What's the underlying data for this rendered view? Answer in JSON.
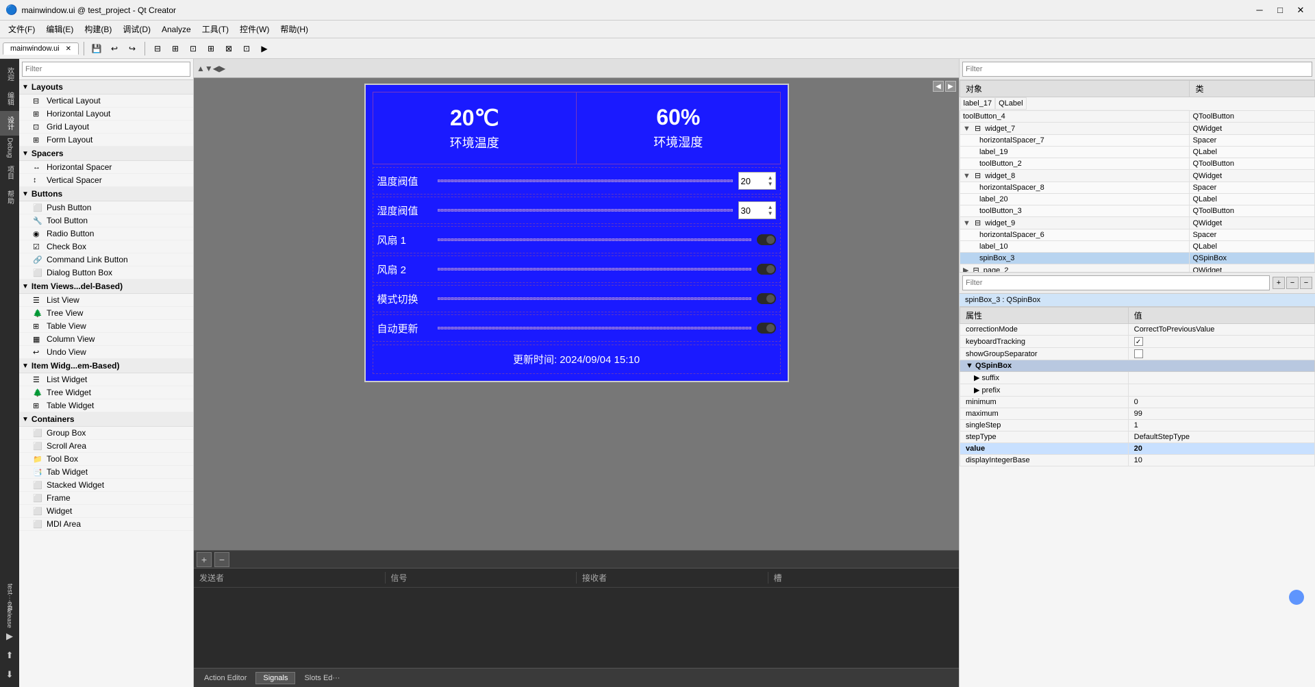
{
  "window": {
    "title": "mainwindow.ui @ test_project - Qt Creator",
    "minimize": "─",
    "maximize": "□",
    "close": "✕"
  },
  "menubar": {
    "items": [
      "文件(F)",
      "编辑(E)",
      "构建(B)",
      "调试(D)",
      "Analyze",
      "工具(T)",
      "控件(W)",
      "帮助(H)"
    ]
  },
  "toolbar": {
    "tab": "mainwindow.ui",
    "close_tab": "✕"
  },
  "left_nav": {
    "buttons": [
      "欢迎",
      "编辑",
      "设计",
      "Debug",
      "项目",
      "帮助"
    ]
  },
  "widget_panel": {
    "filter_placeholder": "Filter",
    "sections": {
      "layouts": {
        "label": "Layouts",
        "items": [
          {
            "icon": "▦",
            "label": "Vertical Layout"
          },
          {
            "icon": "▤",
            "label": "Horizontal Layout"
          },
          {
            "icon": "▣",
            "label": "Grid Layout"
          },
          {
            "icon": "▥",
            "label": "Form Layout"
          }
        ]
      },
      "spacers": {
        "label": "Spacers",
        "items": [
          {
            "icon": "↔",
            "label": "Horizontal Spacer"
          },
          {
            "icon": "↕",
            "label": "Vertical Spacer"
          }
        ]
      },
      "buttons": {
        "label": "Buttons",
        "items": [
          {
            "icon": "⬜",
            "label": "Push Button"
          },
          {
            "icon": "🔧",
            "label": "Tool Button"
          },
          {
            "icon": "◉",
            "label": "Radio Button"
          },
          {
            "icon": "☑",
            "label": "Check Box"
          },
          {
            "icon": "🔗",
            "label": "Command Link Button"
          },
          {
            "icon": "⬜",
            "label": "Dialog Button Box"
          }
        ]
      },
      "itemviews": {
        "label": "Item Views...del-Based)",
        "items": [
          {
            "icon": "☰",
            "label": "List View"
          },
          {
            "icon": "🌲",
            "label": "Tree View"
          },
          {
            "icon": "⊞",
            "label": "Table View"
          },
          {
            "icon": "▦",
            "label": "Column View"
          },
          {
            "icon": "↩",
            "label": "Undo View"
          }
        ]
      },
      "itemwidgets": {
        "label": "Item Widg...em-Based)",
        "items": [
          {
            "icon": "☰",
            "label": "List Widget"
          },
          {
            "icon": "🌲",
            "label": "Tree Widget"
          },
          {
            "icon": "⊞",
            "label": "Table Widget"
          }
        ]
      },
      "containers": {
        "label": "Containers",
        "items": [
          {
            "icon": "⬜",
            "label": "Group Box"
          },
          {
            "icon": "⬜",
            "label": "Scroll Area"
          },
          {
            "icon": "📁",
            "label": "Tool Box"
          },
          {
            "icon": "📑",
            "label": "Tab Widget"
          },
          {
            "icon": "⬜",
            "label": "Stacked Widget"
          },
          {
            "icon": "⬜",
            "label": "Frame"
          },
          {
            "icon": "⬜",
            "label": "Widget"
          },
          {
            "icon": "⬜",
            "label": "MDI Area"
          }
        ]
      }
    }
  },
  "canvas": {
    "temp_value": "20℃",
    "temp_label": "环境温度",
    "humidity_value": "60%",
    "humidity_label": "环境湿度",
    "rows": [
      {
        "label": "温度阀值",
        "type": "spinbox",
        "value": "20"
      },
      {
        "label": "湿度阀值",
        "type": "spinbox",
        "value": "30"
      },
      {
        "label": "风扇 1",
        "type": "toggle"
      },
      {
        "label": "风扇 2",
        "type": "toggle"
      },
      {
        "label": "模式切换",
        "type": "toggle"
      },
      {
        "label": "自动更新",
        "type": "toggle"
      }
    ],
    "footer_text": "更新时间: 2024/09/04 15:10"
  },
  "bottom": {
    "tabs": [
      "Action Editor",
      "Signals",
      "Slots Ed···"
    ],
    "active_tab": "Signals",
    "add_btn": "+",
    "remove_btn": "−",
    "columns": [
      "发送者",
      "信号",
      "接收者",
      "槽"
    ]
  },
  "right_panel": {
    "filter_placeholder": "Filter",
    "header_col1": "对象",
    "header_col2": "类",
    "objects": [
      {
        "name": "label_17",
        "class": "QLabel",
        "level": 0,
        "expanded": false
      },
      {
        "name": "toolButton_4",
        "class": "QToolButton",
        "level": 0,
        "expanded": false
      },
      {
        "name": "widget_7",
        "class": "QWidget",
        "level": 0,
        "expanded": true,
        "has_children": true
      },
      {
        "name": "horizontalSpacer_7",
        "class": "Spacer",
        "level": 1,
        "parent": "widget_7"
      },
      {
        "name": "label_19",
        "class": "QLabel",
        "level": 1,
        "parent": "widget_7"
      },
      {
        "name": "toolButton_2",
        "class": "QToolButton",
        "level": 1,
        "parent": "widget_7"
      },
      {
        "name": "widget_8",
        "class": "QWidget",
        "level": 0,
        "expanded": true,
        "has_children": true
      },
      {
        "name": "horizontalSpacer_8",
        "class": "Spacer",
        "level": 1,
        "parent": "widget_8"
      },
      {
        "name": "label_20",
        "class": "QLabel",
        "level": 1,
        "parent": "widget_8"
      },
      {
        "name": "toolButton_3",
        "class": "QToolButton",
        "level": 1,
        "parent": "widget_8"
      },
      {
        "name": "widget_9",
        "class": "QWidget",
        "level": 0,
        "expanded": true,
        "has_children": true
      },
      {
        "name": "horizontalSpacer_6",
        "class": "Spacer",
        "level": 1,
        "parent": "widget_9"
      },
      {
        "name": "label_10",
        "class": "QLabel",
        "level": 1,
        "parent": "widget_9"
      },
      {
        "name": "spinBox_3",
        "class": "QSpinBox",
        "level": 1,
        "parent": "widget_9",
        "selected": true
      },
      {
        "name": "page_2",
        "class": "QWidget",
        "level": 0,
        "expanded": false
      }
    ]
  },
  "props_panel": {
    "filter_placeholder": "Filter",
    "add_btn": "+",
    "remove_btn": "−",
    "collapse_btn": "−",
    "context_label": "spinBox_3 : QSpinBox",
    "header_col1": "属性",
    "header_col2": "值",
    "properties": [
      {
        "name": "correctionMode",
        "value": "CorrectToPreviousValue",
        "bold": false
      },
      {
        "name": "keyboardTracking",
        "value": "checkbox_checked",
        "bold": false
      },
      {
        "name": "showGroupSeparator",
        "value": "checkbox_unchecked",
        "bold": false
      },
      {
        "name": "QSpinBox",
        "value": "",
        "section": true
      },
      {
        "name": "suffix",
        "value": "",
        "expandable": true,
        "bold": false
      },
      {
        "name": "prefix",
        "value": "",
        "expandable": true,
        "bold": false
      },
      {
        "name": "minimum",
        "value": "0",
        "bold": false
      },
      {
        "name": "maximum",
        "value": "99",
        "bold": false
      },
      {
        "name": "singleStep",
        "value": "1",
        "bold": false
      },
      {
        "name": "stepType",
        "value": "DefaultStepType",
        "bold": false
      },
      {
        "name": "value",
        "value": "20",
        "bold": true,
        "highlighted": true
      },
      {
        "name": "displayIntegerBase",
        "value": "10",
        "bold": false
      }
    ]
  }
}
